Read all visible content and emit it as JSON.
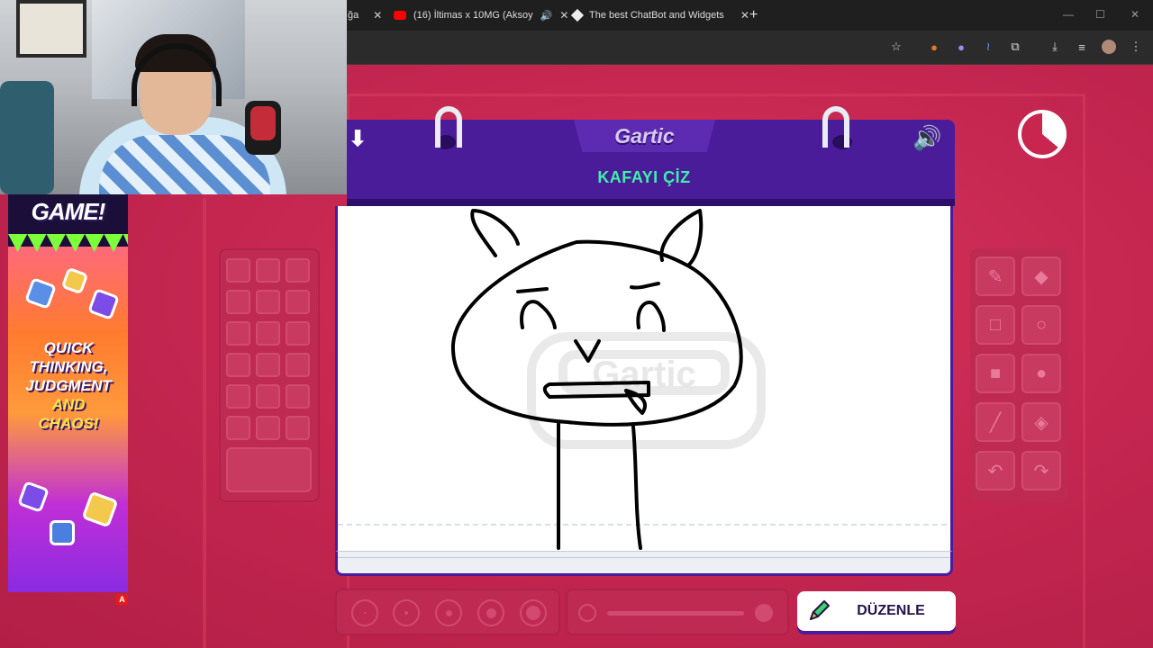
{
  "browser": {
    "tabs": [
      {
        "label": "ğa",
        "close": "✕"
      },
      {
        "label": "(16) İltimas x 10MG (Aksoy",
        "close": "✕",
        "icon": "youtube-icon",
        "audio": "🔊"
      },
      {
        "label": "The best ChatBot and Widgets",
        "close": "✕",
        "icon": "diamond-icon"
      }
    ],
    "new_tab": "+",
    "window_controls": {
      "minimize": "—",
      "maximize": "☐",
      "close": "✕"
    }
  },
  "ad": {
    "title": "GAME!",
    "line1": "QUICK",
    "line2": "THINKING,",
    "line3": "JUDGMENT",
    "line4": "AND",
    "line5": "CHAOS!",
    "ad_choices": "A"
  },
  "game": {
    "logo": "Gartic",
    "prompt": "KAFAYI ÇİZ",
    "download_icon": "⬇",
    "sound_icon": "🔊",
    "edit_button": "DÜZENLE",
    "colors": {
      "header": "#4b1c9a",
      "accent_text": "#3ef0a8",
      "background": "#c8264f"
    }
  }
}
